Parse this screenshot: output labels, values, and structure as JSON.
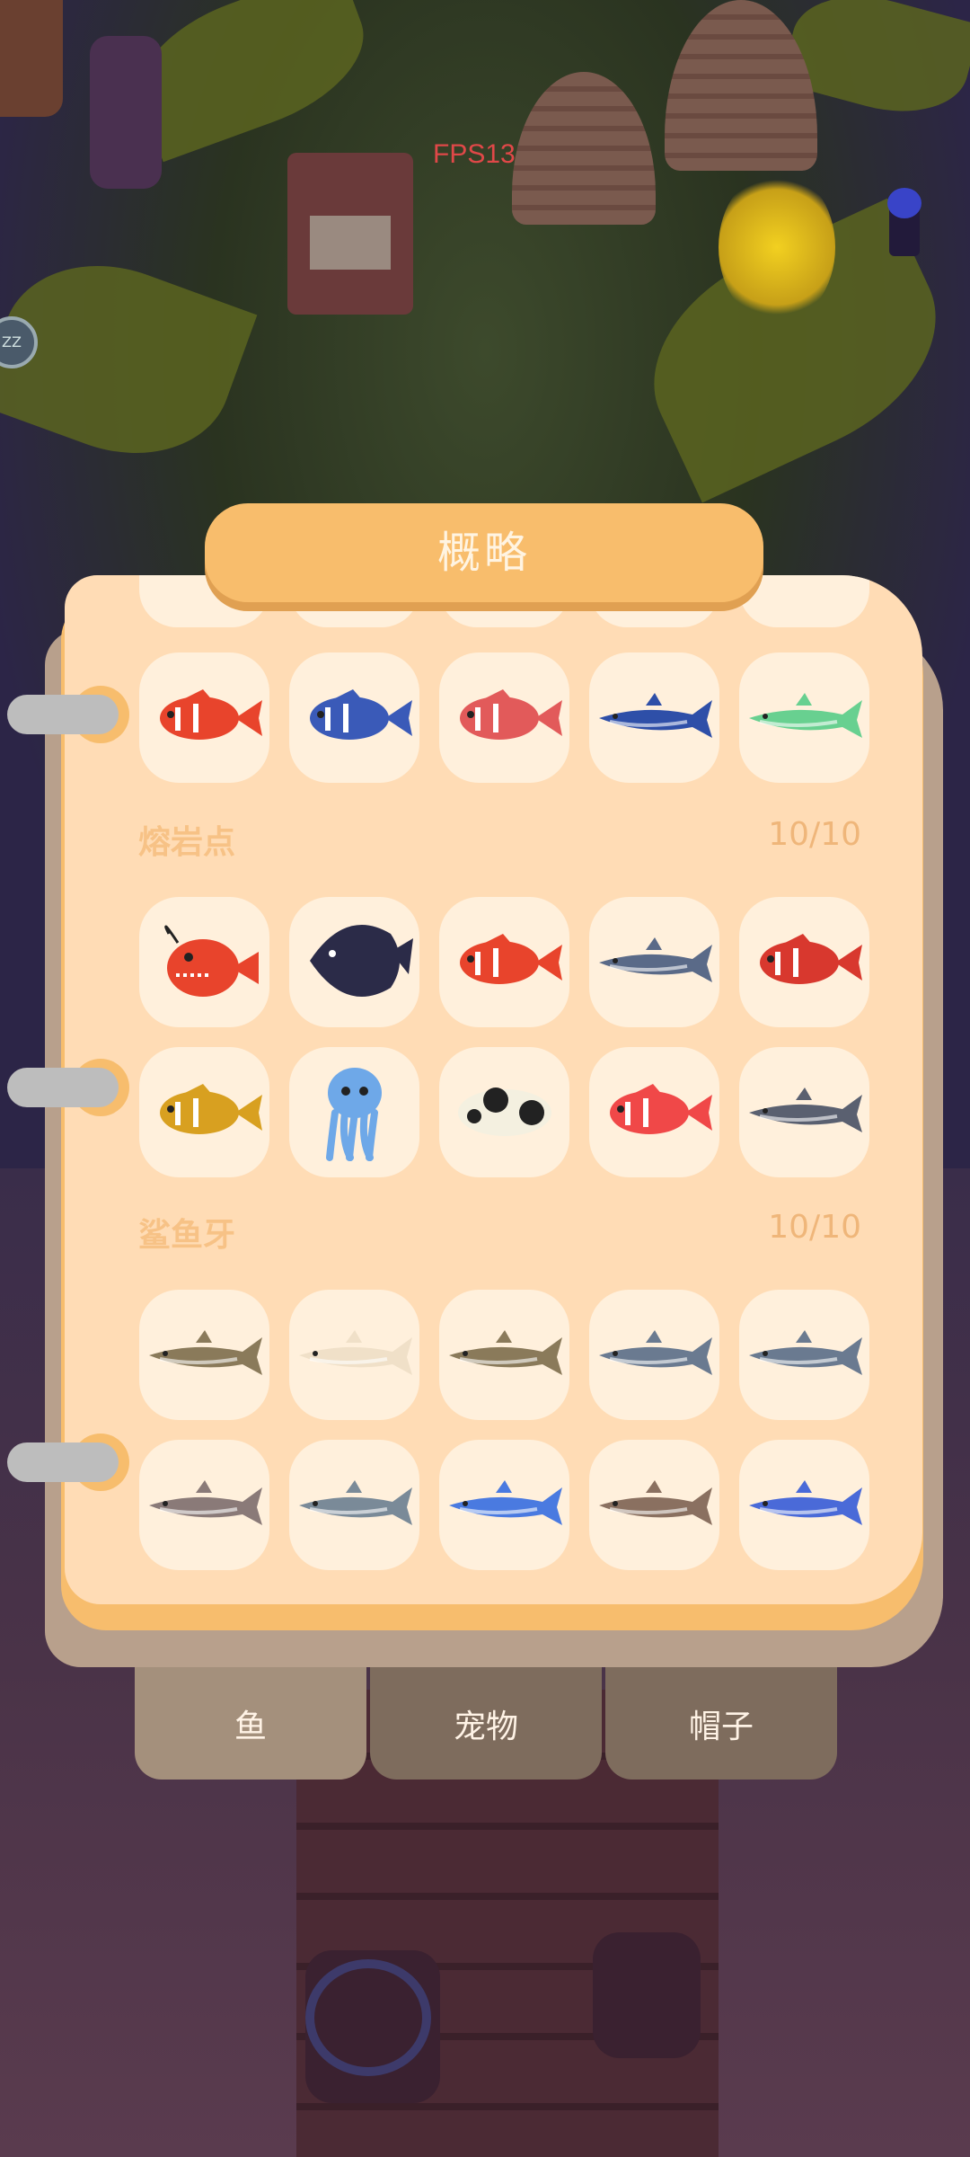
{
  "hud": {
    "fps_text": "FPS13"
  },
  "side_button": {
    "label": "ZZ"
  },
  "panel": {
    "title": "概略",
    "sections": [
      {
        "name": "",
        "fish": [
          {
            "icon": "clownfish-icon",
            "color": "#e8442c"
          },
          {
            "icon": "triggerfish-icon",
            "color": "#3a5ab8"
          },
          {
            "icon": "red-snapper-icon",
            "color": "#e25a5a"
          },
          {
            "icon": "sailfish-icon",
            "color": "#2e4fa8"
          },
          {
            "icon": "wahoo-icon",
            "color": "#68d090"
          }
        ]
      },
      {
        "name": "熔岩点",
        "count": "10/10",
        "fish": [
          {
            "icon": "anglerfish-icon",
            "color": "#e8442c"
          },
          {
            "icon": "black-tang-icon",
            "color": "#2b2b48"
          },
          {
            "icon": "orange-clownfish-icon",
            "color": "#e8442c"
          },
          {
            "icon": "swordfish-icon",
            "color": "#5a6a88"
          },
          {
            "icon": "spotted-red-fish-icon",
            "color": "#d8382e"
          },
          {
            "icon": "tiger-grouper-icon",
            "color": "#d8a020"
          },
          {
            "icon": "blue-octopus-icon",
            "color": "#6ea8e8"
          },
          {
            "icon": "panda-pufferfish-icon",
            "color": "#f4f0e0"
          },
          {
            "icon": "red-yellow-fish-icon",
            "color": "#f04848"
          },
          {
            "icon": "whale-shark-icon",
            "color": "#5a6070"
          }
        ]
      },
      {
        "name": "鲨鱼牙",
        "count": "10/10",
        "fish": [
          {
            "icon": "sawfish-icon",
            "color": "#8a7a5a"
          },
          {
            "icon": "pale-fish-icon",
            "color": "#f0e0c8"
          },
          {
            "icon": "gar-icon",
            "color": "#8a7a5a"
          },
          {
            "icon": "grey-shark-icon",
            "color": "#6a7a90"
          },
          {
            "icon": "great-white-shark-icon",
            "color": "#6a7a90"
          },
          {
            "icon": "tiger-shark-icon",
            "color": "#8a7a78"
          },
          {
            "icon": "mako-shark-icon",
            "color": "#7a8a98"
          },
          {
            "icon": "needlefish-icon",
            "color": "#4a7ae0"
          },
          {
            "icon": "sawshark-icon",
            "color": "#8a7060"
          },
          {
            "icon": "blue-shark-icon",
            "color": "#4a6ad8"
          }
        ]
      }
    ]
  },
  "tabs": [
    {
      "label": "鱼"
    },
    {
      "label": "宠物"
    },
    {
      "label": "帽子"
    }
  ]
}
